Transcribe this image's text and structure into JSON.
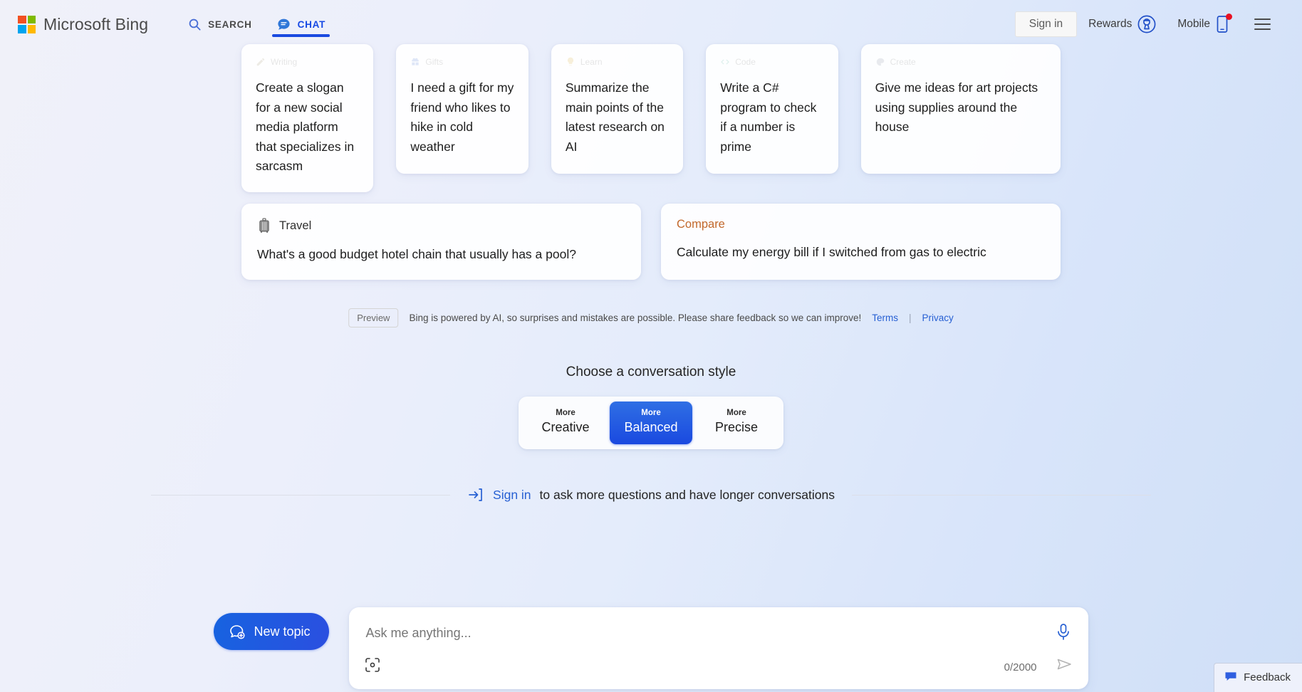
{
  "header": {
    "brand": "Microsoft Bing",
    "logo_icon": "microsoft-logo",
    "tabs": [
      {
        "label": "SEARCH",
        "icon": "search-icon",
        "active": false
      },
      {
        "label": "CHAT",
        "icon": "chat-bubble-icon",
        "active": true
      }
    ],
    "sign_in": "Sign in",
    "rewards": "Rewards",
    "rewards_icon": "rewards-medal-icon",
    "mobile": "Mobile",
    "mobile_icon": "mobile-phone-icon",
    "menu_icon": "hamburger-menu-icon",
    "notification_dot_color": "#e81123"
  },
  "suggestion_cards": [
    {
      "text": "Create a slogan for a new social media platform that specializes in sarcasm"
    },
    {
      "text": "I need a gift for my friend who likes to hike in cold weather"
    },
    {
      "text": "Summarize the main points of the latest research on AI"
    },
    {
      "text": "Write a C# program to check if a number is prime"
    },
    {
      "text": "Give me ideas for art projects using supplies around the house"
    }
  ],
  "prompt_cards": [
    {
      "category": "Travel",
      "category_icon": "suitcase-icon",
      "category_color": "#30302f",
      "question": "What's a good budget hotel chain that usually has a pool?"
    },
    {
      "category": "Compare",
      "category_icon": "",
      "category_color": "#c2682b",
      "question": "Calculate my energy bill if I switched from gas to electric"
    }
  ],
  "disclaimer": {
    "preview_badge": "Preview",
    "text": "Bing is powered by AI, so surprises and mistakes are possible. Please share feedback so we can improve!",
    "terms": "Terms",
    "separator": "|",
    "privacy": "Privacy"
  },
  "conversation_style": {
    "title": "Choose a conversation style",
    "options": [
      {
        "small": "More",
        "big": "Creative",
        "selected": false
      },
      {
        "small": "More",
        "big": "Balanced",
        "selected": true
      },
      {
        "small": "More",
        "big": "Precise",
        "selected": false
      }
    ],
    "selected_color": "#1a49e0"
  },
  "signin_prompt": {
    "icon": "sign-in-arrow-icon",
    "link": "Sign in",
    "tail": " to ask more questions and have longer conversations"
  },
  "composer": {
    "new_topic": "New topic",
    "new_topic_icon": "new-chat-plus-icon",
    "placeholder": "Ask me anything...",
    "input_value": "",
    "counter": "0/2000",
    "mic_icon": "microphone-icon",
    "visual_search_icon": "visual-search-icon",
    "send_icon": "send-arrow-icon",
    "accent_color": "#1763e0"
  },
  "feedback": {
    "label": "Feedback",
    "icon": "feedback-bubble-icon"
  }
}
